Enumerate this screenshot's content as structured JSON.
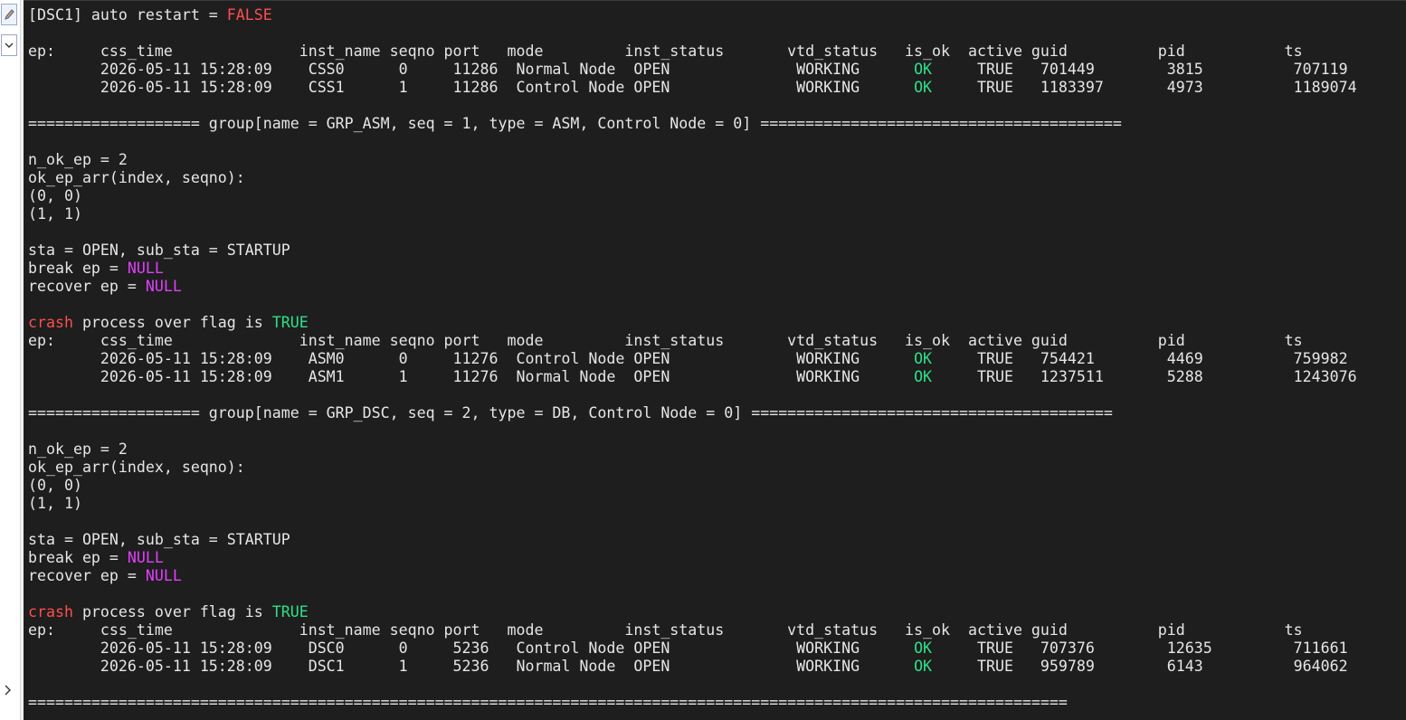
{
  "icons": {
    "edit": "pencil-icon",
    "dropdown": "chevron-down-icon",
    "expand": "chevron-right-icon"
  },
  "colors": {
    "background": "#1e1e1e",
    "text": "#e6e6e6",
    "false_value": "#ff4d4d",
    "ok_value": "#2ee08a",
    "null_value": "#e040fb"
  },
  "console": {
    "auto_restart_prefix": "[DSC1] auto restart = ",
    "auto_restart_value": "FALSE",
    "css_ep": {
      "header": "ep:     css_time              inst_name seqno port   mode         inst_status       vtd_status   is_ok  active guid          pid           ts",
      "rows": [
        {
          "pre": "        2026-05-11 15:28:09    CSS0      0     11286  Normal Node  OPEN              WORKING      ",
          "ok": "OK",
          "post": "     TRUE   701449        3815          707119"
        },
        {
          "pre": "        2026-05-11 15:28:09    CSS1      1     11286  Control Node OPEN              WORKING      ",
          "ok": "OK",
          "post": "     TRUE   1183397       4973          1189074"
        }
      ]
    },
    "groups": [
      {
        "separator": "=================== group[name = GRP_ASM, seq = 1, type = ASM, Control Node = 0] ========================================",
        "n_ok_ep": "n_ok_ep = 2",
        "arr_label": "ok_ep_arr(index, seqno):",
        "arr_rows": [
          "(0, 0)",
          "(1, 1)"
        ],
        "sta": "sta = OPEN, sub_sta = STARTUP",
        "break_prefix": "break ep = ",
        "break_value": "NULL",
        "recover_prefix": "recover ep = ",
        "recover_value": "NULL",
        "crash_word": "crash",
        "crash_mid": " process over flag is ",
        "crash_value": "TRUE",
        "header": "ep:     css_time              inst_name seqno port   mode         inst_status       vtd_status   is_ok  active guid          pid           ts",
        "rows": [
          {
            "pre": "        2026-05-11 15:28:09    ASM0      0     11276  Control Node OPEN              WORKING      ",
            "ok": "OK",
            "post": "     TRUE   754421        4469          759982"
          },
          {
            "pre": "        2026-05-11 15:28:09    ASM1      1     11276  Normal Node  OPEN              WORKING      ",
            "ok": "OK",
            "post": "     TRUE   1237511       5288          1243076"
          }
        ]
      },
      {
        "separator": "=================== group[name = GRP_DSC, seq = 2, type = DB, Control Node = 0] ========================================",
        "n_ok_ep": "n_ok_ep = 2",
        "arr_label": "ok_ep_arr(index, seqno):",
        "arr_rows": [
          "(0, 0)",
          "(1, 1)"
        ],
        "sta": "sta = OPEN, sub_sta = STARTUP",
        "break_prefix": "break ep = ",
        "break_value": "NULL",
        "recover_prefix": "recover ep = ",
        "recover_value": "NULL",
        "crash_word": "crash",
        "crash_mid": " process over flag is ",
        "crash_value": "TRUE",
        "header": "ep:     css_time              inst_name seqno port   mode         inst_status       vtd_status   is_ok  active guid          pid           ts",
        "rows": [
          {
            "pre": "        2026-05-11 15:28:09    DSC0      0     5236   Control Node OPEN              WORKING      ",
            "ok": "OK",
            "post": "     TRUE   707376        12635         711661"
          },
          {
            "pre": "        2026-05-11 15:28:09    DSC1      1     5236   Normal Node  OPEN              WORKING      ",
            "ok": "OK",
            "post": "     TRUE   959789        6143          964062"
          }
        ]
      }
    ],
    "footer_separator": "==================================================================================================================="
  }
}
